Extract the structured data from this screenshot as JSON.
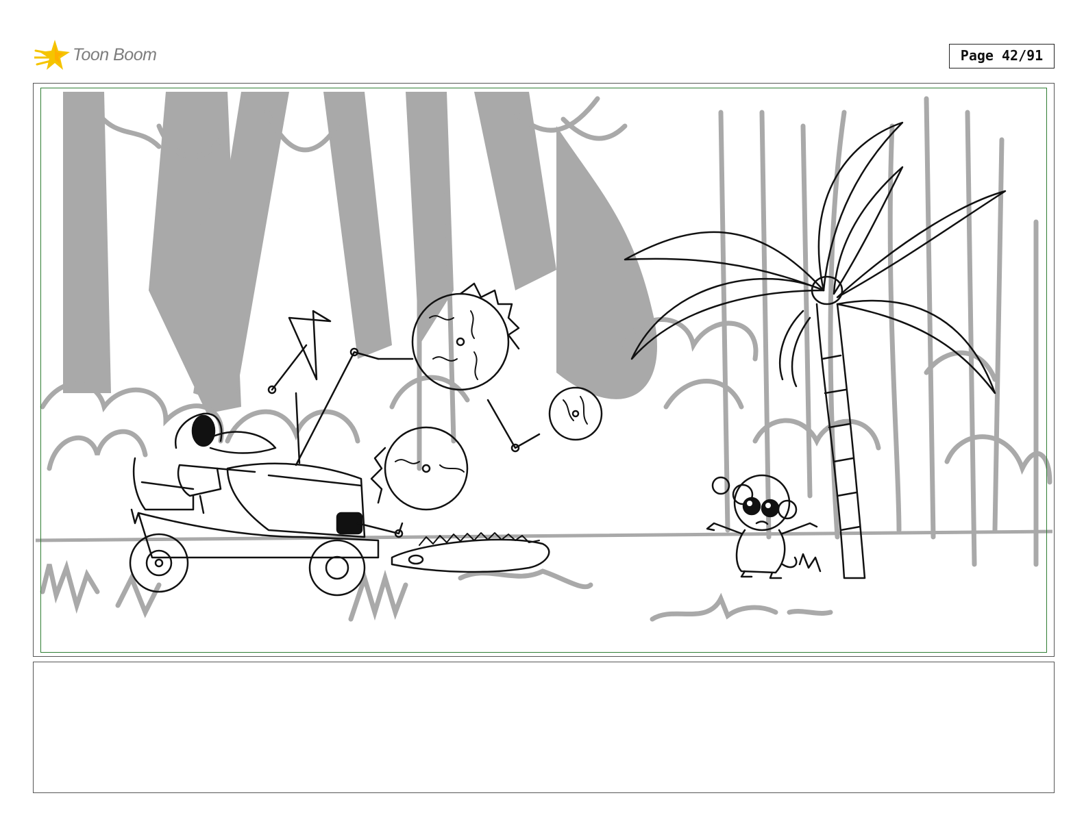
{
  "header": {
    "logo_text": "Toon Boom",
    "logo_icon": "comet-star-icon",
    "page_label": "Page 42/91"
  },
  "colors": {
    "logo_yellow": "#f5c400",
    "logo_text": "#7d7d7d",
    "safe_frame": "#2e7d32",
    "background_sketch": "#a9a9a9",
    "ink": "#111111"
  },
  "panel": {
    "caption": ""
  }
}
